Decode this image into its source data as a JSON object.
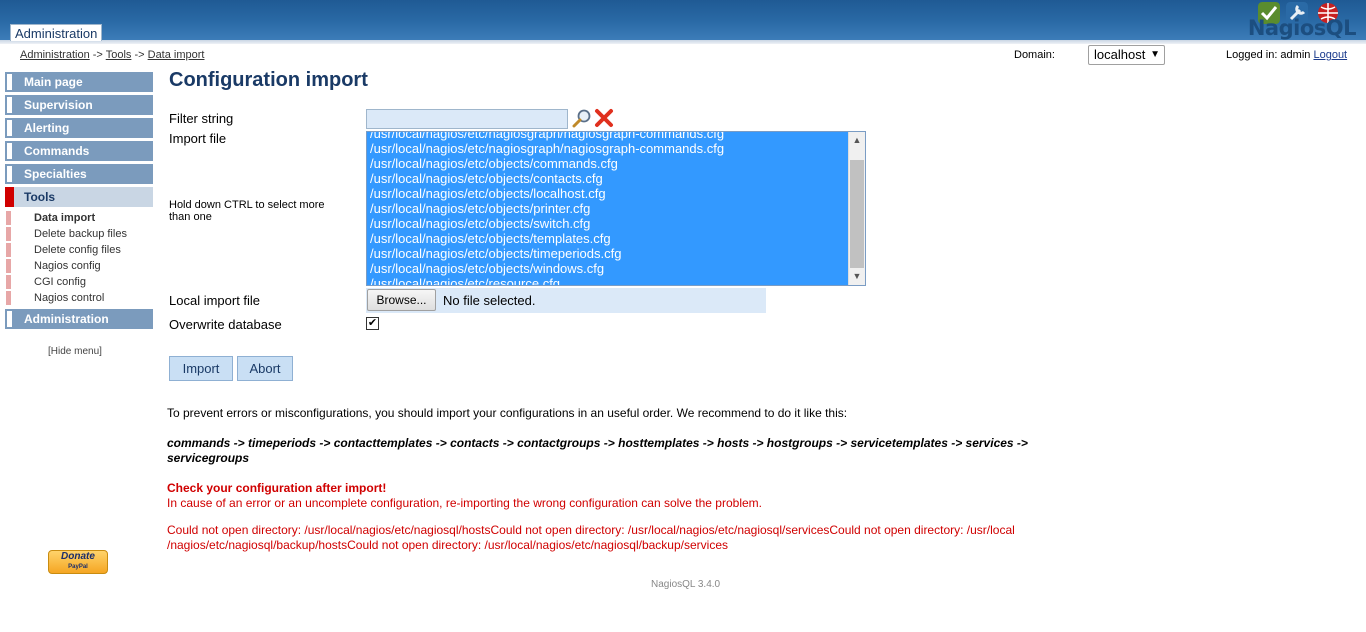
{
  "header": {
    "admin_tab": "Administration",
    "logo_text": "NagiosQL"
  },
  "breadcrumb": {
    "item1": "Administration",
    "sep1": "->",
    "item2": "Tools",
    "sep2": "->",
    "item3": "Data import"
  },
  "domain": {
    "label": "Domain:",
    "selected": "localhost"
  },
  "login": {
    "text": "Logged in: admin",
    "logout": "Logout"
  },
  "sidebar": {
    "items": [
      {
        "label": "Main page"
      },
      {
        "label": "Supervision"
      },
      {
        "label": "Alerting"
      },
      {
        "label": "Commands"
      },
      {
        "label": "Specialties"
      },
      {
        "label": "Tools"
      },
      {
        "label": "Administration"
      }
    ],
    "tools_sub": [
      "Data import",
      "Delete backup files",
      "Delete config files",
      "Nagios config",
      "CGI config",
      "Nagios control"
    ],
    "hide_menu": "[Hide menu]",
    "donate": "Donate",
    "donate_sub": "PayPal"
  },
  "main": {
    "title": "Configuration import",
    "filter_label": "Filter string",
    "filter_value": "",
    "import_label": "Import file",
    "hint": "Hold down CTRL to select more than one",
    "files": [
      "/usr/local/nagios/etc/nagiosgraph/nagiosgraph-commands.cfg",
      "/usr/local/nagios/etc/nagiosgraph/nagiosgraph-commands.cfg",
      "/usr/local/nagios/etc/objects/commands.cfg",
      "/usr/local/nagios/etc/objects/contacts.cfg",
      "/usr/local/nagios/etc/objects/localhost.cfg",
      "/usr/local/nagios/etc/objects/printer.cfg",
      "/usr/local/nagios/etc/objects/switch.cfg",
      "/usr/local/nagios/etc/objects/templates.cfg",
      "/usr/local/nagios/etc/objects/timeperiods.cfg",
      "/usr/local/nagios/etc/objects/windows.cfg",
      "/usr/local/nagios/etc/resource.cfg"
    ],
    "local_import_label": "Local import file",
    "browse_label": "Browse...",
    "file_status": "No file selected.",
    "overwrite_label": "Overwrite database",
    "overwrite_checked": "✔",
    "import_btn": "Import",
    "abort_btn": "Abort",
    "info_text": "To prevent errors or misconfigurations, you should import your configurations in an useful order. We recommend to do it like this:",
    "order_text": "commands -> timeperiods -> contacttemplates -> contacts -> contactgroups -> hosttemplates -> hosts -> hostgroups -> servicetemplates -> services -> servicegroups",
    "check_title": "Check your configuration after import!",
    "check_text": "In cause of an error or an uncomplete configuration, re-importing the wrong configuration can solve the problem.",
    "error_line1": "Could not open directory: /usr/local/nagios/etc/nagiosql/hostsCould not open directory: /usr/local/nagios/etc/nagiosql/servicesCould not open directory: /usr/local",
    "error_line2": "/nagios/etc/nagiosql/backup/hostsCould not open directory: /usr/local/nagios/etc/nagiosql/backup/services"
  },
  "footer": "NagiosQL 3.4.0",
  "colors": {
    "header_blue": "#1f5a94",
    "nav_blue": "#7b9bbd",
    "active_marker": "#d00000",
    "selection_blue": "#3399ff",
    "error_red": "#d00000"
  }
}
